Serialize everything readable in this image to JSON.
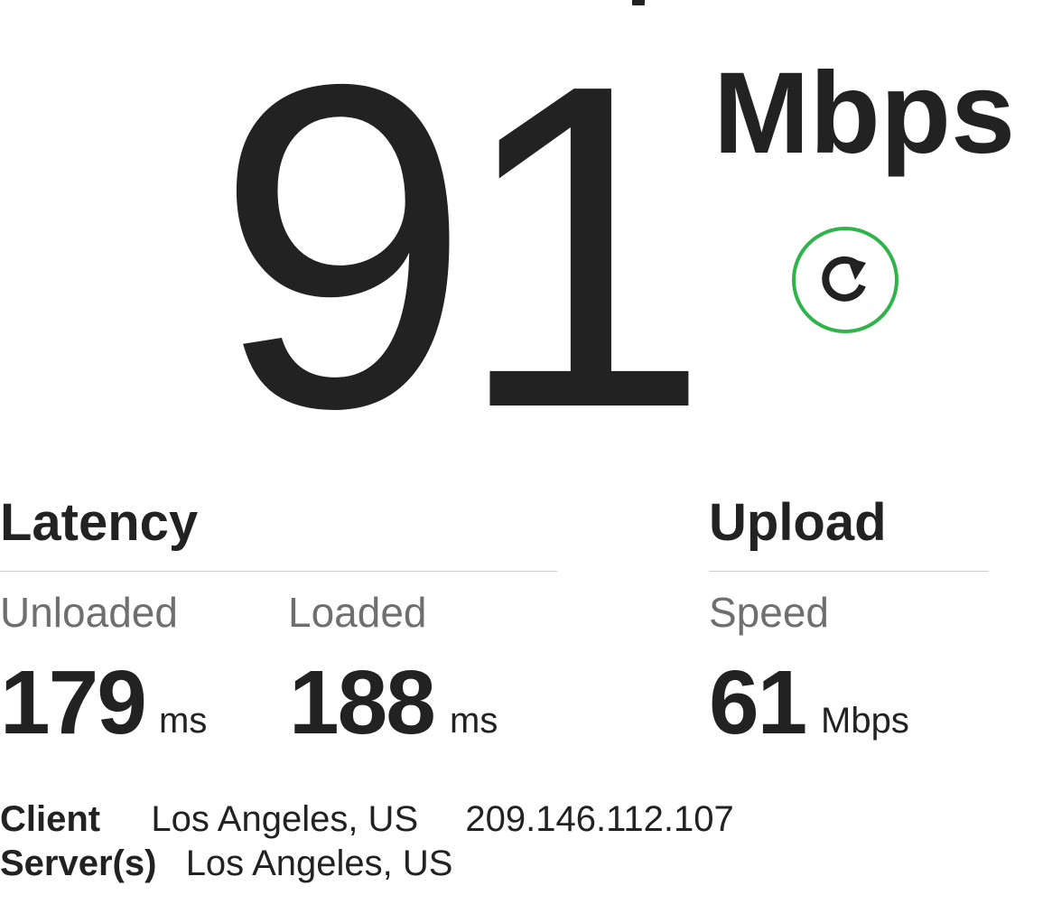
{
  "download": {
    "value": "91",
    "unit": "Mbps"
  },
  "retest": {
    "icon": "refresh-icon",
    "ring_color": "#2fb34a"
  },
  "latency": {
    "title": "Latency",
    "unloaded": {
      "label": "Unloaded",
      "value": "179",
      "unit": "ms"
    },
    "loaded": {
      "label": "Loaded",
      "value": "188",
      "unit": "ms"
    }
  },
  "upload": {
    "title": "Upload",
    "speed": {
      "label": "Speed",
      "value": "61",
      "unit": "Mbps"
    }
  },
  "info": {
    "client_label": "Client",
    "client_location": "Los Angeles, US",
    "client_ip": "209.146.112.107",
    "server_label": "Server(s)",
    "server_location": "Los Angeles, US"
  },
  "colors": {
    "text": "#222222",
    "muted": "#6f6f6f",
    "accent": "#2fb34a",
    "divider": "#cfcfcf"
  }
}
